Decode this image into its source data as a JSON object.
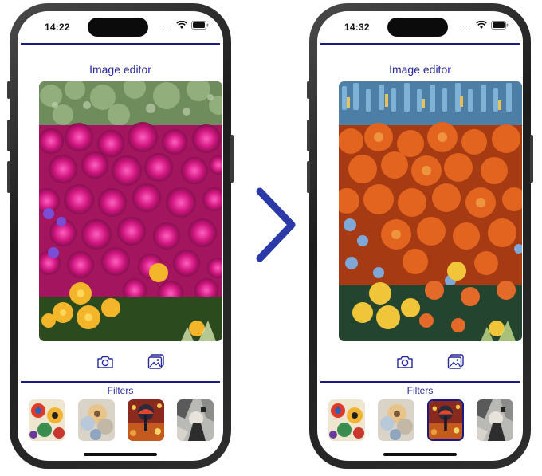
{
  "left_phone": {
    "status_time": "14:22",
    "title": "Image editor",
    "filters_label": "Filters",
    "selected_filter": 0,
    "photo_style": "original"
  },
  "right_phone": {
    "status_time": "14:32",
    "title": "Image editor",
    "filters_label": "Filters",
    "selected_filter": 3,
    "photo_style": "stylized"
  },
  "icons": [
    "camera-icon",
    "photo-library-icon",
    "wifi-icon",
    "battery-icon",
    "chevron-right-icon"
  ],
  "colors": {
    "accent": "#1a1a80",
    "title_text": "#27279a",
    "arrow": "#2b3aa8"
  }
}
